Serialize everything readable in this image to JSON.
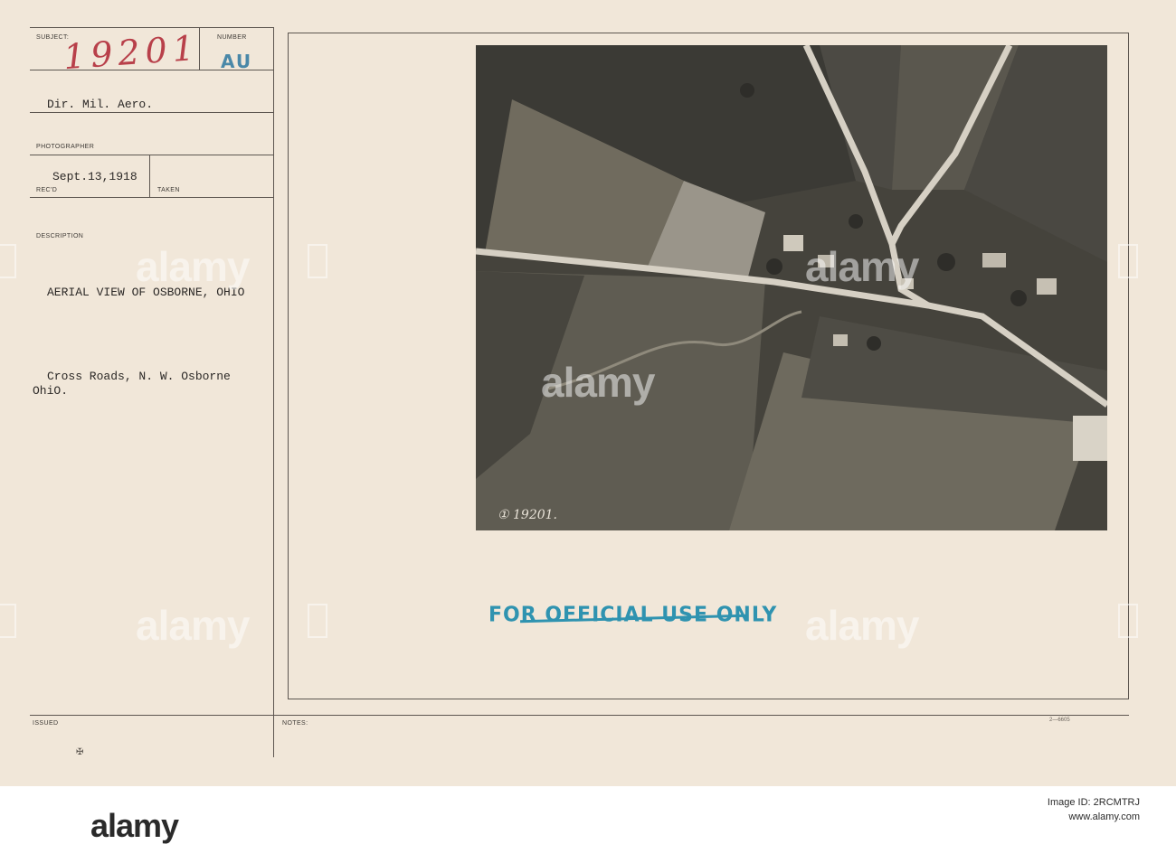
{
  "record": {
    "labels": {
      "subject": "SUBJECT:",
      "number": "NUMBER",
      "photographer": "PHOTOGRAPHER",
      "recd": "REC'D",
      "taken": "TAKEN",
      "description": "DESCRIPTION",
      "issued": "ISSUED",
      "notes": "NOTES:"
    },
    "subject_number": "19201",
    "number_code": "AU",
    "source": "Dir. Mil. Aero.",
    "date_received": "Sept.13,1918",
    "title": "AERIAL VIEW OF OSBORNE, OHIO",
    "description_line1": "Cross Roads, N. W. Osborne",
    "description_line2": "OhiO.",
    "negative_number": "① 19201.",
    "stamp": "FOR OFFICIAL USE ONLY",
    "issued_mark": "✠",
    "form_code": "2—6605"
  },
  "watermark": {
    "text": "alamy"
  },
  "footer": {
    "logo": "alamy",
    "image_id": "Image ID: 2RCMTRJ",
    "site": "www.alamy.com"
  },
  "colors": {
    "card": "#f1e7d9",
    "handwriting": "#b8404a",
    "stamp_blue": "#2f93b0",
    "au_blue": "#4a88a8"
  }
}
